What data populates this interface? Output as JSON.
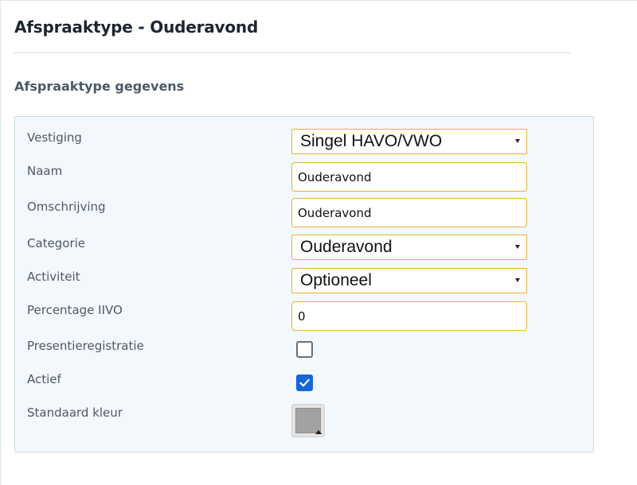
{
  "page": {
    "title": "Afspraaktype - Ouderavond",
    "section_heading": "Afspraaktype gegevens"
  },
  "form": {
    "vestiging": {
      "label": "Vestiging",
      "value": "Singel HAVO/VWO"
    },
    "naam": {
      "label": "Naam",
      "value": "Ouderavond"
    },
    "omschrijving": {
      "label": "Omschrijving",
      "value": "Ouderavond"
    },
    "categorie": {
      "label": "Categorie",
      "value": "Ouderavond"
    },
    "activiteit": {
      "label": "Activiteit",
      "value": "Optioneel"
    },
    "percentage_iivo": {
      "label": "Percentage IIVO",
      "value": "0"
    },
    "presentieregistratie": {
      "label": "Presentieregistratie",
      "checked": false
    },
    "actief": {
      "label": "Actief",
      "checked": true
    },
    "standaard_kleur": {
      "label": "Standaard kleur",
      "color": "#a2a2a2"
    }
  },
  "icons": {
    "select_caret": "caret-down-icon",
    "checkmark": "checkmark-icon",
    "color_picker_arrow": "triangle-up-icon"
  },
  "colors": {
    "field_border": "#e8b22e",
    "panel_background": "#f3f8fc",
    "checkbox_checked": "#1667d9"
  }
}
